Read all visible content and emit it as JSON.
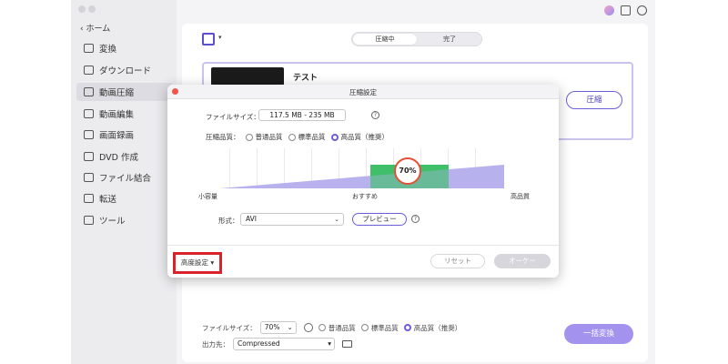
{
  "sidebar": {
    "home_label": "‹ ホーム",
    "items": [
      {
        "label": "変換",
        "icon": "convert-icon"
      },
      {
        "label": "ダウンロード",
        "icon": "download-icon"
      },
      {
        "label": "動画圧縮",
        "icon": "compress-icon",
        "active": true
      },
      {
        "label": "動画編集",
        "icon": "scissors-icon"
      },
      {
        "label": "画面録画",
        "icon": "screen-record-icon"
      },
      {
        "label": "DVD 作成",
        "icon": "dvd-icon"
      },
      {
        "label": "ファイル結合",
        "icon": "merge-icon"
      },
      {
        "label": "転送",
        "icon": "transfer-icon"
      },
      {
        "label": "ツール",
        "icon": "toolbox-icon"
      }
    ]
  },
  "main": {
    "tabs": [
      "圧縮中",
      "完了"
    ],
    "file": {
      "name": "テスト"
    },
    "compress_button": "圧縮",
    "bottom": {
      "filesize_label": "ファイルサイズ：",
      "filesize_value": "70%",
      "quality_options": [
        "普通品質",
        "標準品質",
        "高品質（推奨）"
      ],
      "quality_selected": 2,
      "output_label": "出力先：",
      "output_value": "Compressed",
      "convert_all_button": "一括変換"
    }
  },
  "modal": {
    "title": "圧縮設定",
    "filesize_label": "ファイルサイズ：",
    "filesize_value": "117.5 MB - 235 MB",
    "quality_label": "圧縮品質：",
    "quality_options": [
      "普通品質",
      "標準品質",
      "高品質（推奨）"
    ],
    "quality_selected": 2,
    "percent": "70%",
    "percent_value": 0.7,
    "scale_labels": {
      "low": "小容量",
      "mid": "おすすめ",
      "high": "高品質"
    },
    "format_label": "形式：",
    "format_value": "AVI",
    "preview_button": "プレビュー",
    "advanced_button": "高度設定",
    "reset_button": "リセット",
    "ok_button": "オーケー"
  },
  "colors": {
    "accent": "#6a5ddc",
    "highlight_box": "#d9232a",
    "slider_recommended": "#3fbf6a",
    "slider_fill": "#b7b3ee",
    "close_dot": "#f0564b"
  }
}
